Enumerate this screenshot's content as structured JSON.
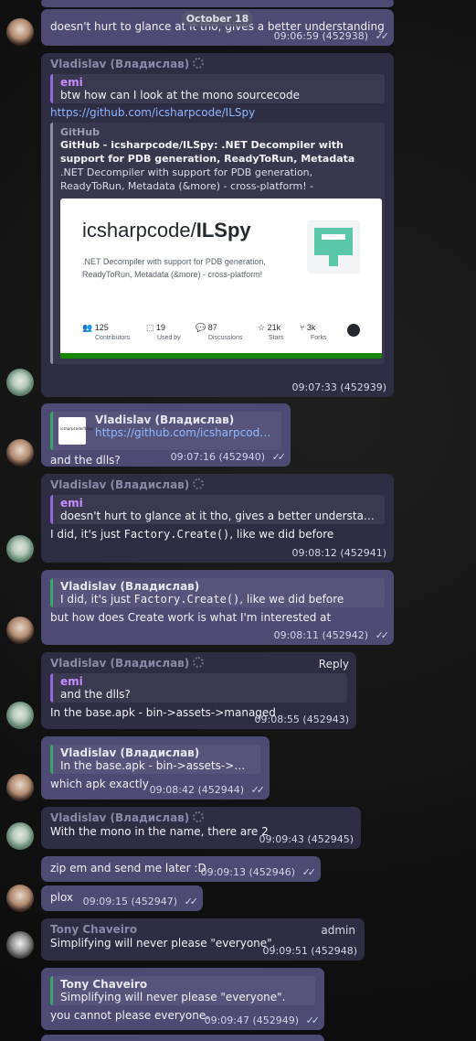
{
  "date_separator": "October 18",
  "messages": [
    {
      "text": "doesn't hurt to glance at it tho, gives a better understanding",
      "time": "09:06:59",
      "id": "(452938)"
    },
    {
      "sender": "Vladislav (Владислав)",
      "reply_to": {
        "name": "emi",
        "text": "btw how can I look at the mono sourcecode"
      },
      "link": "https://github.com/icsharpcode/ILSpy",
      "preview": {
        "site": "GitHub",
        "title": "GitHub - icsharpcode/ILSpy: .NET Decompiler with support for PDB generation, ReadyToRun, Metadata (&more) - cross-pla...",
        "description": ".NET Decompiler with support for PDB generation, ReadyToRun, Metadata (&more) - cross-platform! - icsharpcod...",
        "card_title_prefix": "icsharpcode/",
        "card_title_repo": "ILSpy",
        "card_description": ".NET Decompiler with support for PDB generation, ReadyToRun, Metadata (&more) - cross-platform!",
        "stats": [
          {
            "value": "125",
            "label": "Contributors"
          },
          {
            "value": "19",
            "label": "Used by"
          },
          {
            "value": "87",
            "label": "Discussions"
          },
          {
            "value": "21k",
            "label": "Stars"
          },
          {
            "value": "3k",
            "label": "Forks"
          }
        ]
      },
      "time": "09:07:33",
      "id": "(452939)"
    },
    {
      "reply_to": {
        "name": "Vladislav (Владислав)",
        "text": "https://github.com/icsharpcode/ILSpy",
        "thumb_text": "icsharpcode/ILSpy"
      },
      "text": "and the dlls?",
      "time": "09:07:16",
      "id": "(452940)"
    },
    {
      "sender": "Vladislav (Владислав)",
      "reply_to": {
        "name": "emi",
        "text": "doesn't hurt to glance at it tho, gives a better understanding"
      },
      "text_prefix": "I did, it's just ",
      "code": "Factory.Create()",
      "text_suffix": ", like we did before",
      "time": "09:08:12",
      "id": "(452941)"
    },
    {
      "reply_to": {
        "name": "Vladislav (Владислав)",
        "text_prefix": "I did, it's just ",
        "code": "Factory.Create()",
        "text_suffix": ", like we did before"
      },
      "text": "but how does Create work is what I'm interested at",
      "time": "09:08:11",
      "id": "(452942)"
    },
    {
      "sender": "Vladislav (Владислав)",
      "reply_label": "Reply",
      "reply_to": {
        "name": "emi",
        "text": "and the dlls?"
      },
      "text": "In the base.apk - bin->assets->managed",
      "time": "09:08:55",
      "id": "(452943)"
    },
    {
      "reply_to": {
        "name": "Vladislav (Владислав)",
        "text": "In the base.apk - bin->assets->managed"
      },
      "text": "which apk exactly",
      "time": "09:08:42",
      "id": "(452944)"
    },
    {
      "sender": "Vladislav (Владислав)",
      "text": "With the mono in the name, there are 2",
      "time": "09:09:43",
      "id": "(452945)"
    },
    {
      "text": "zip em and send me later :D",
      "time": "09:09:13",
      "id": "(452946)"
    },
    {
      "text": "plox",
      "time": "09:09:15",
      "id": "(452947)"
    },
    {
      "sender": "Tony Chaveiro",
      "badge": "admin",
      "text": "Simplifying will never please \"everyone\".",
      "time": "09:09:51",
      "id": "(452948)"
    },
    {
      "reply_to": {
        "name": "Tony Chaveiro",
        "text": "Simplifying will never please \"everyone\"."
      },
      "text": "you cannot please everyone.",
      "time": "09:09:47",
      "id": "(452949)"
    }
  ],
  "colors": {
    "outgoing_bubble": "#4d4a73",
    "incoming_bubble": "#2e2d44",
    "quote_purple": "#8f6ad8",
    "quote_green": "#39a865",
    "link": "#8fb8ff"
  }
}
